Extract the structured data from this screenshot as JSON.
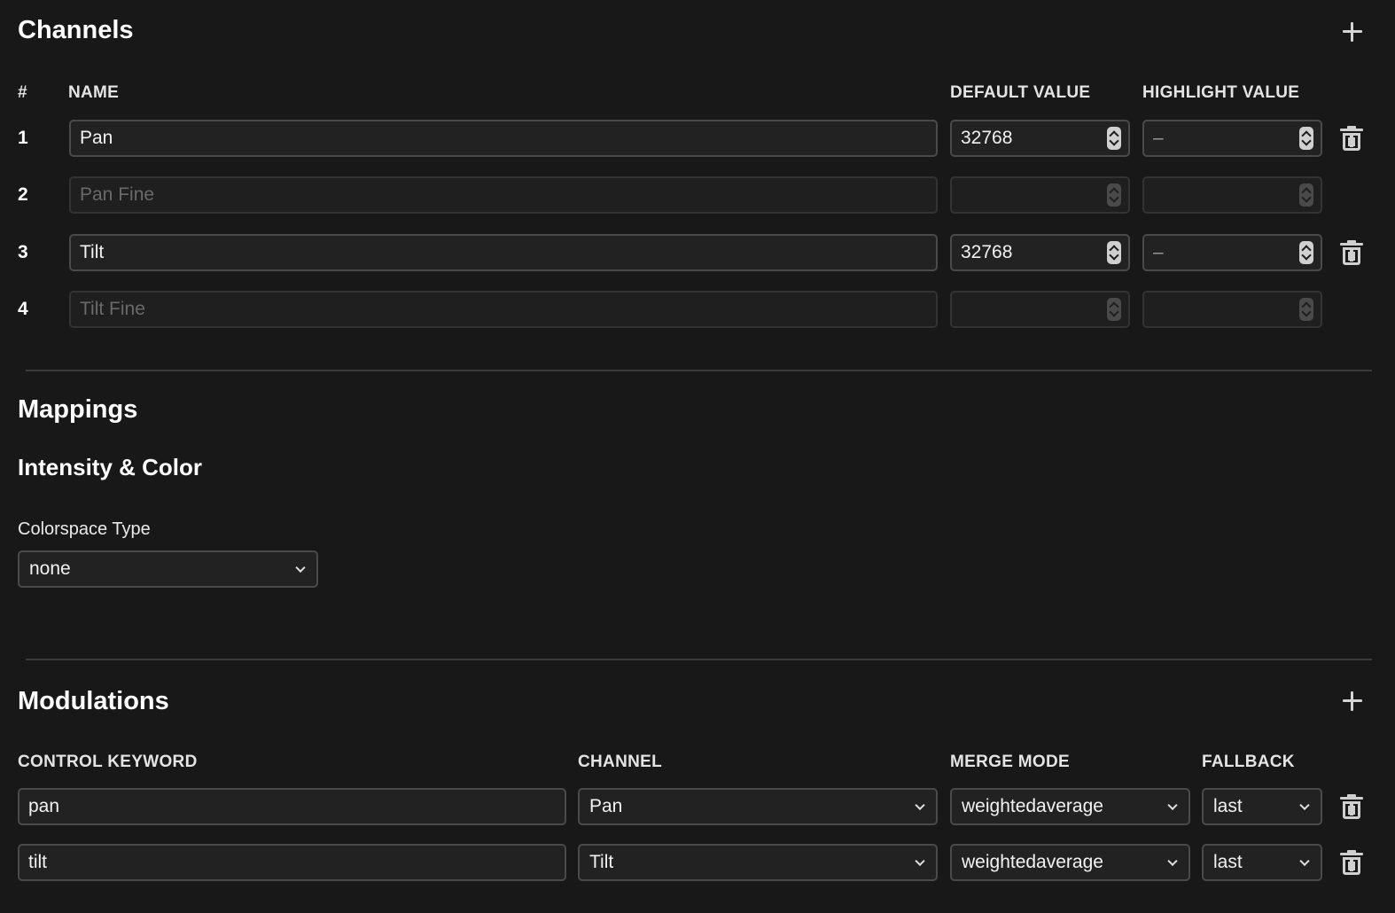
{
  "channels": {
    "title": "Channels",
    "add_icon": "plus-icon",
    "headers": {
      "num": "#",
      "name": "NAME",
      "default": "DEFAULT VALUE",
      "highlight": "HIGHLIGHT VALUE"
    },
    "rows": [
      {
        "num": "1",
        "name": "Pan",
        "name_placeholder": "",
        "default": "32768",
        "highlight": "–"
      },
      {
        "num": "2",
        "name": "",
        "name_placeholder": "Pan Fine",
        "default": "",
        "highlight": ""
      },
      {
        "num": "3",
        "name": "Tilt",
        "name_placeholder": "",
        "default": "32768",
        "highlight": "–"
      },
      {
        "num": "4",
        "name": "",
        "name_placeholder": "Tilt Fine",
        "default": "",
        "highlight": ""
      }
    ]
  },
  "mappings": {
    "title": "Mappings",
    "intensity_title": "Intensity & Color",
    "colorspace_label": "Colorspace Type",
    "colorspace_value": "none"
  },
  "modulations": {
    "title": "Modulations",
    "add_icon": "plus-icon",
    "headers": {
      "keyword": "CONTROL KEYWORD",
      "channel": "CHANNEL",
      "merge": "MERGE MODE",
      "fallback": "FALLBACK"
    },
    "rows": [
      {
        "keyword": "pan",
        "channel": "Pan",
        "merge": "weightedaverage",
        "fallback": "last"
      },
      {
        "keyword": "tilt",
        "channel": "Tilt",
        "merge": "weightedaverage",
        "fallback": "last"
      }
    ]
  },
  "icons": {
    "delete": "trash-icon",
    "spinner": "spinner-icon",
    "dropdown": "chevron-down-icon"
  },
  "colors": {
    "background": "#181818",
    "field_bg": "#222222",
    "field_border": "#4a4a4a",
    "text": "#f2f2f2"
  }
}
